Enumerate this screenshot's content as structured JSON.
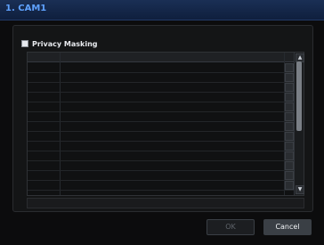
{
  "window": {
    "title": "1. CAM1"
  },
  "privacy_masking": {
    "label": "Privacy Masking",
    "checked": true
  },
  "table": {
    "headers": [
      "",
      "",
      ""
    ],
    "rows": [
      {
        "idx": "",
        "area": ""
      },
      {
        "idx": "",
        "area": ""
      },
      {
        "idx": "",
        "area": ""
      },
      {
        "idx": "",
        "area": ""
      },
      {
        "idx": "",
        "area": ""
      },
      {
        "idx": "",
        "area": ""
      },
      {
        "idx": "",
        "area": ""
      },
      {
        "idx": "",
        "area": ""
      },
      {
        "idx": "",
        "area": ""
      },
      {
        "idx": "",
        "area": ""
      },
      {
        "idx": "",
        "area": ""
      },
      {
        "idx": "",
        "area": ""
      },
      {
        "idx": "",
        "area": ""
      }
    ]
  },
  "buttons": {
    "ok": "OK",
    "cancel": "Cancel"
  },
  "colors": {
    "title": "#5fa2ff",
    "cancel_bg": "#3a3f45"
  }
}
